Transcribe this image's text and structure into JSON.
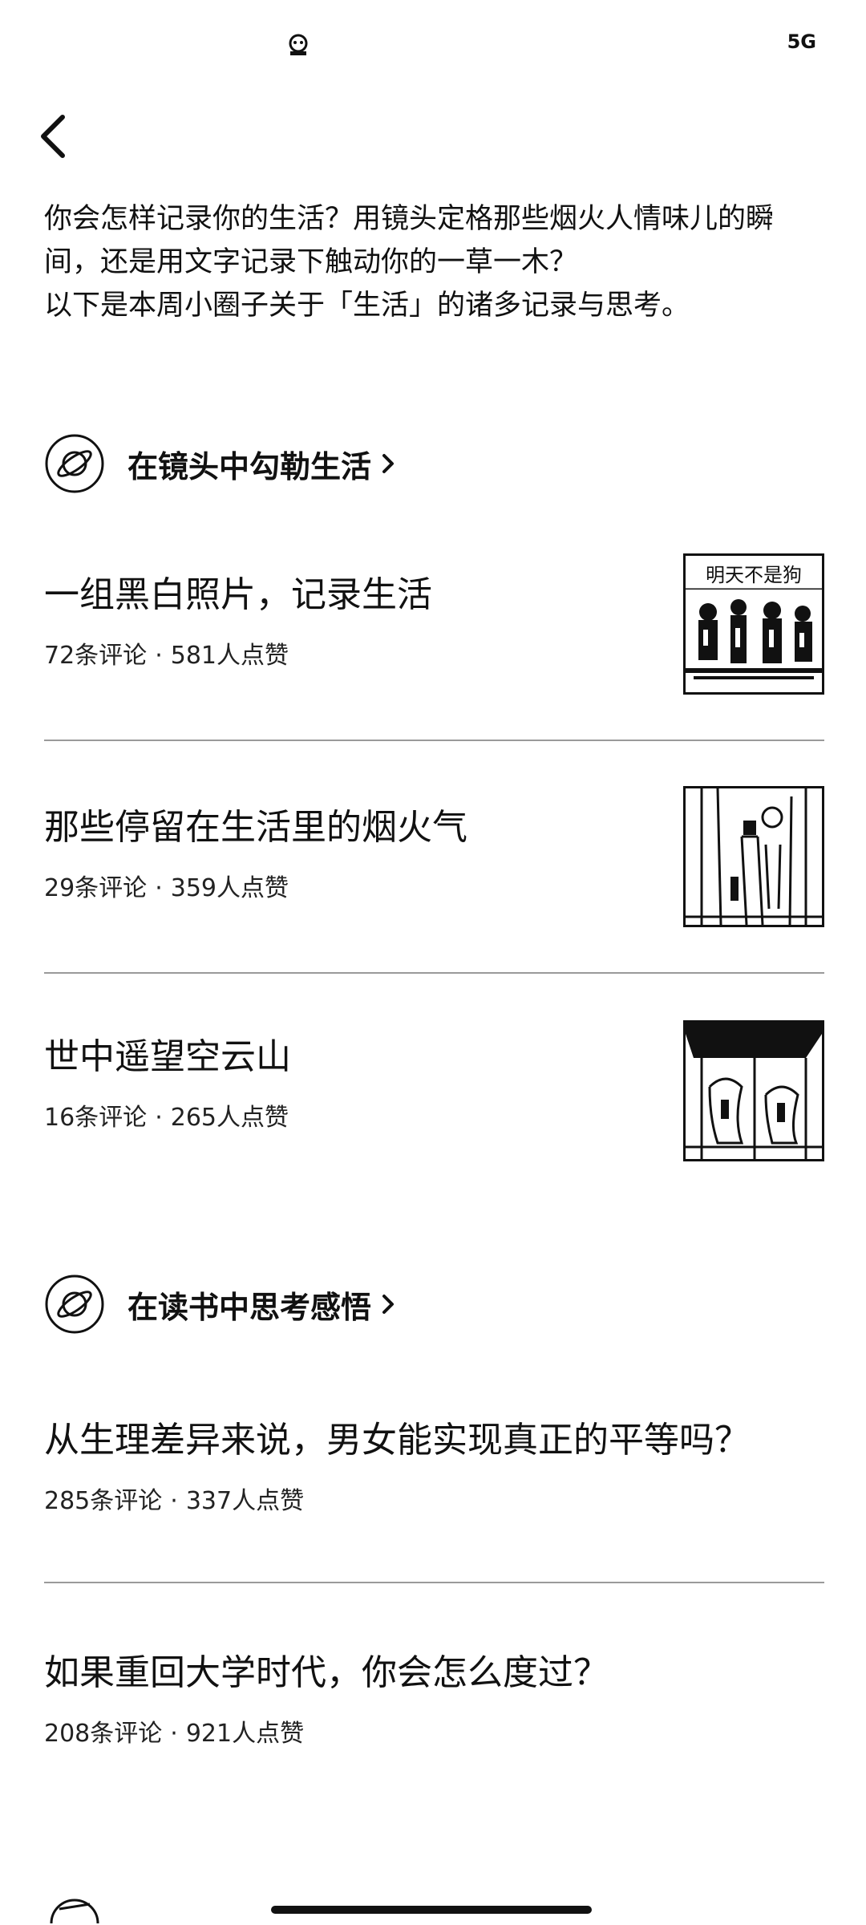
{
  "status_bar": {
    "right_text": "5G",
    "left_icon": "notification-app-icon"
  },
  "nav": {
    "back_icon": "chevron-left-icon"
  },
  "intro": {
    "line1": "你会怎样记录你的生活？用镜头定格那些烟火人情味儿的瞬",
    "line2": "间，还是用文字记录下触动你的一草一木？",
    "line3": "以下是本周小圈子关于「生活」的诸多记录与思考。"
  },
  "sections": [
    {
      "label": "在镜头中勾勒生活",
      "icon": "planet-icon",
      "items": [
        {
          "title": "一组黑白照片，记录生活",
          "comments": "72条评论",
          "likes": "581人点赞",
          "thumb_text": "明天不是狗"
        },
        {
          "title": "那些停留在生活里的烟火气",
          "comments": "29条评论",
          "likes": "359人点赞"
        },
        {
          "title": "世中遥望空云山",
          "comments": "16条评论",
          "likes": "265人点赞"
        }
      ]
    },
    {
      "label": "在读书中思考感悟",
      "icon": "planet-icon",
      "items": [
        {
          "title": "从生理差异来说，男女能实现真正的平等吗？",
          "comments": "285条评论",
          "likes": "337人点赞"
        },
        {
          "title": "如果重回大学时代，你会怎么度过？",
          "comments": "208条评论",
          "likes": "921人点赞"
        }
      ]
    }
  ],
  "separator": "·"
}
